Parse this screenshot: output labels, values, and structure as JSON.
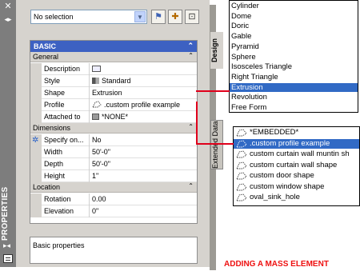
{
  "palette": {
    "title": "PROPERTIES",
    "selection": {
      "value": "No selection"
    },
    "tabs": {
      "design": "Design",
      "extended": "Extended Data"
    }
  },
  "basic": {
    "header": "BASIC",
    "general": {
      "header": "General",
      "rows": [
        {
          "label": "Description",
          "value": ""
        },
        {
          "label": "Style",
          "value": "Standard"
        },
        {
          "label": "Shape",
          "value": "Extrusion"
        },
        {
          "label": "Profile",
          "value": ".custom profile example"
        },
        {
          "label": "Attached to",
          "value": "*NONE*"
        }
      ]
    },
    "dimensions": {
      "header": "Dimensions",
      "rows": [
        {
          "label": "Specify on...",
          "value": "No"
        },
        {
          "label": "Width",
          "value": "50'-0\""
        },
        {
          "label": "Depth",
          "value": "50'-0\""
        },
        {
          "label": "Height",
          "value": "1\""
        }
      ]
    },
    "location": {
      "header": "Location",
      "rows": [
        {
          "label": "Rotation",
          "value": "0.00"
        },
        {
          "label": "Elevation",
          "value": "0\""
        }
      ]
    },
    "footer": "Basic properties"
  },
  "shape_list": {
    "items": [
      "Cylinder",
      "Dome",
      "Doric",
      "Gable",
      "Pyramid",
      "Sphere",
      "Isosceles Triangle",
      "Right Triangle",
      "Extrusion",
      "Revolution",
      "Free Form"
    ],
    "selected": "Extrusion"
  },
  "profile_list": {
    "items": [
      "*EMBEDDED*",
      ".custom profile example",
      "custom curtain wall muntin sh",
      "custom curtain wall shape",
      "custom door shape",
      "custom window shape",
      "oval_sink_hole"
    ],
    "selected": ".custom profile example"
  },
  "caption": "ADDING A MASS ELEMENT",
  "colors": {
    "selection": "#316ac5",
    "section_header": "#3d61c2",
    "callout": "#e0001b"
  }
}
